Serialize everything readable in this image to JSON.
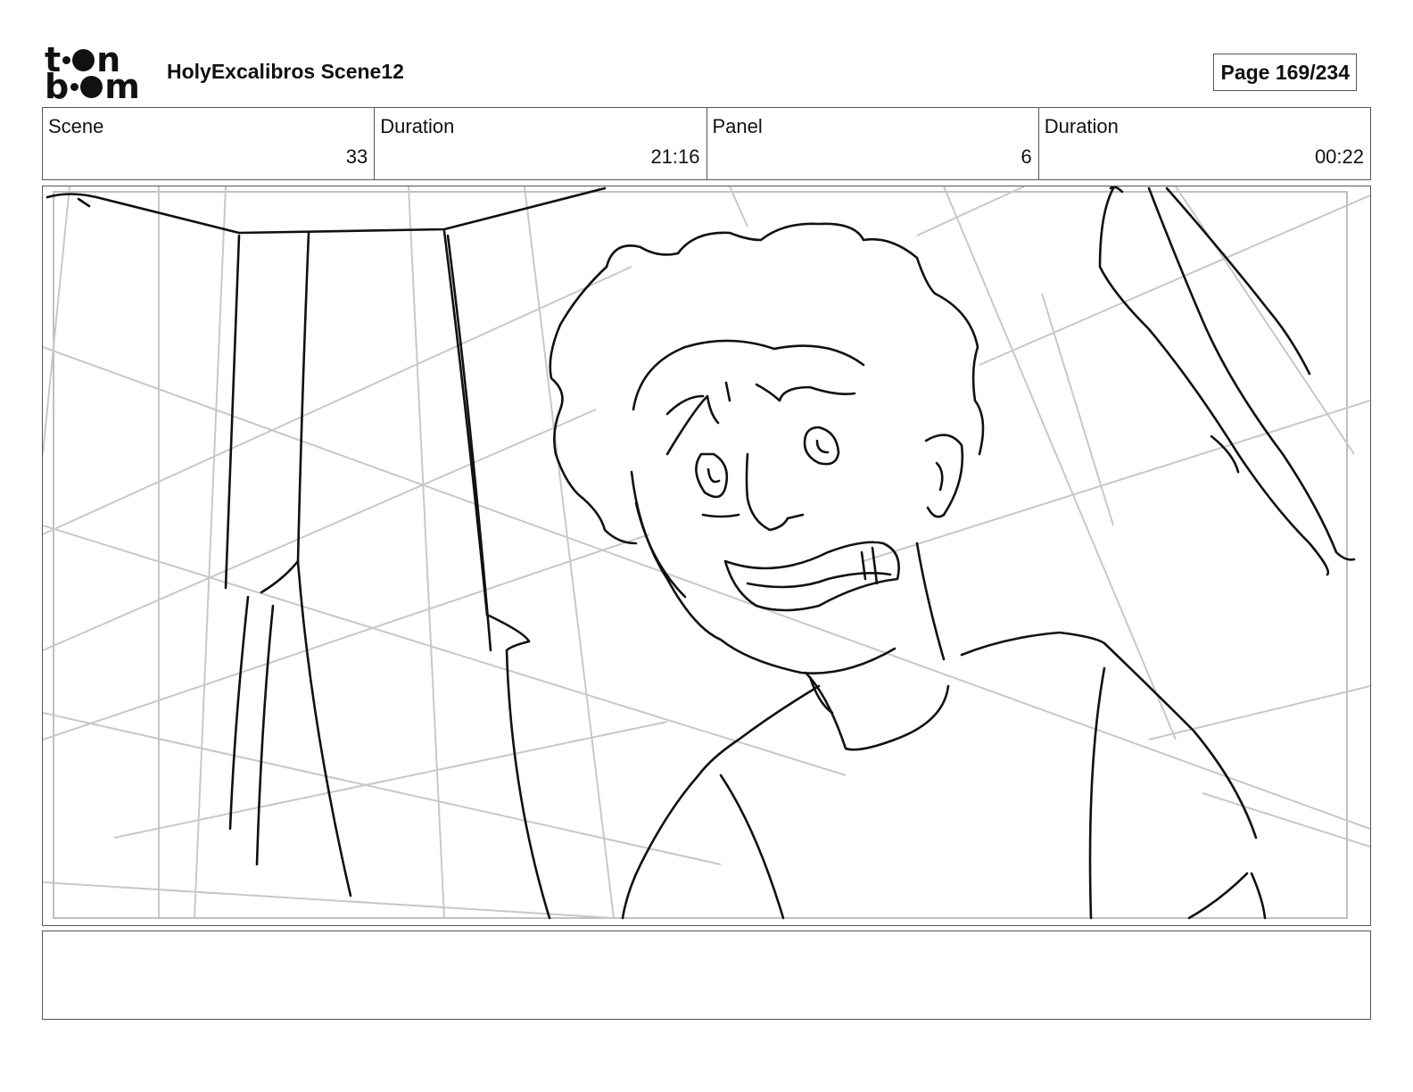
{
  "header": {
    "logo": {
      "line1": [
        "t",
        "n"
      ],
      "line2": [
        "b",
        "m"
      ],
      "alt": "toonboom"
    },
    "title": "HolyExcalibros Scene12",
    "page_label": "Page 169/234"
  },
  "info": {
    "scene_label": "Scene",
    "scene_value": "33",
    "scene_duration_label": "Duration",
    "scene_duration_value": "21:16",
    "panel_label": "Panel",
    "panel_value": "6",
    "panel_duration_label": "Duration",
    "panel_duration_value": "00:22"
  },
  "panel": {
    "image": "storyboard-sketch-smiling-boy",
    "colors": {
      "ink": "#111111",
      "guide": "#c8c8c8",
      "border": "#555555"
    }
  },
  "notes": {
    "text": ""
  }
}
